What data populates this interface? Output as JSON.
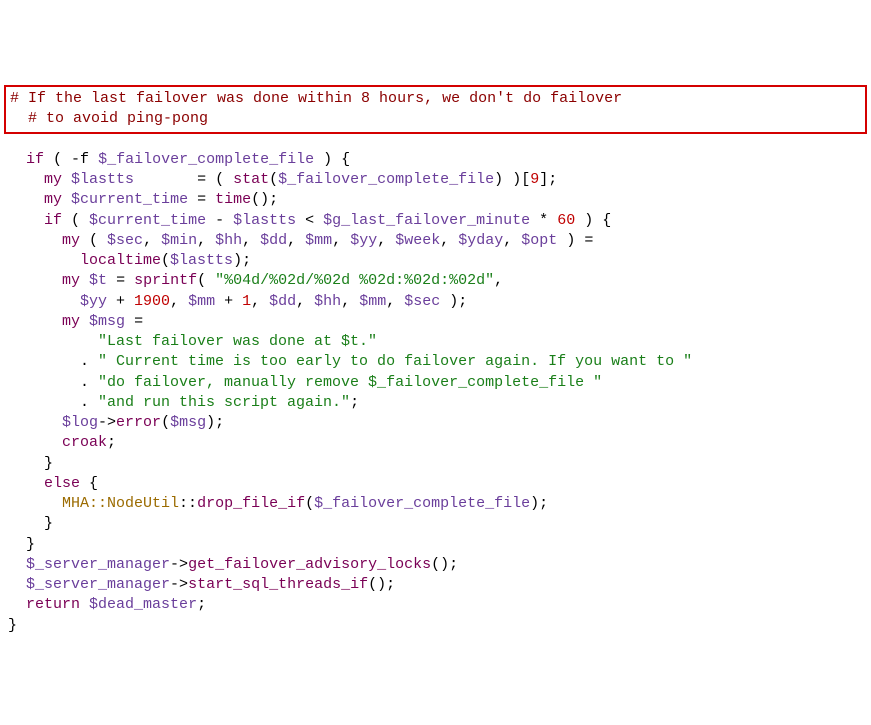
{
  "comments": {
    "c1": "# If the last failover was done within 8 hours, we don't do failover",
    "c2": "# to avoid ping-pong"
  },
  "keywords": {
    "if": "if",
    "my": "my",
    "else": "else",
    "return": "return"
  },
  "vars": {
    "failover_file": "$_failover_complete_file",
    "lastts": "$lastts",
    "current_time": "$current_time",
    "g_last_failover_minute": "$g_last_failover_minute",
    "sec": "$sec",
    "min": "$min",
    "hh": "$hh",
    "dd": "$dd",
    "mm": "$mm",
    "yy": "$yy",
    "week": "$week",
    "yday": "$yday",
    "opt": "$opt",
    "t": "$t",
    "msg": "$msg",
    "log": "$log",
    "server_manager": "$_server_manager",
    "dead_master": "$dead_master"
  },
  "strings": {
    "fmt": "\"%04d/%02d/%02d %02d:%02d:%02d\"",
    "msg1": "\"Last failover was done at $t.\"",
    "msg2": "\" Current time is too early to do failover again. If you want to \"",
    "msg3": "\"do failover, manually remove $_failover_complete_file \"",
    "msg4": "\"and run this script again.\""
  },
  "nums": {
    "nine": "9",
    "sixty": "60",
    "nineteen_hundred": "1900",
    "one": "1"
  },
  "fns": {
    "stat": "stat",
    "time": "time",
    "localtime": "localtime",
    "sprintf": "sprintf",
    "error": "error",
    "croak": "croak",
    "drop_file_if": "drop_file_if",
    "get_failover_advisory_locks": "get_failover_advisory_locks",
    "start_sql_threads_if": "start_sql_threads_if"
  },
  "classes": {
    "mha_nodeutil": "MHA::NodeUtil"
  },
  "punct": {
    "open_cond": "if ( -f ",
    "close_cond": " ) {",
    "open_paren": "(",
    "close_paren": ")",
    "semi": ";",
    "comma": ", ",
    "eq": " = ",
    "lt": " < ",
    "sub": " - ",
    "mul": " * ",
    "add": " + ",
    "brace_open": "{",
    "brace_close": "}",
    "arrow": "->",
    "dot": ". ",
    "dbl_colon": "::",
    "pad_eq": "       = ",
    "open_idx": " )[",
    "close_idx": "];",
    "space": " ",
    "open_cond_plain": "( "
  }
}
